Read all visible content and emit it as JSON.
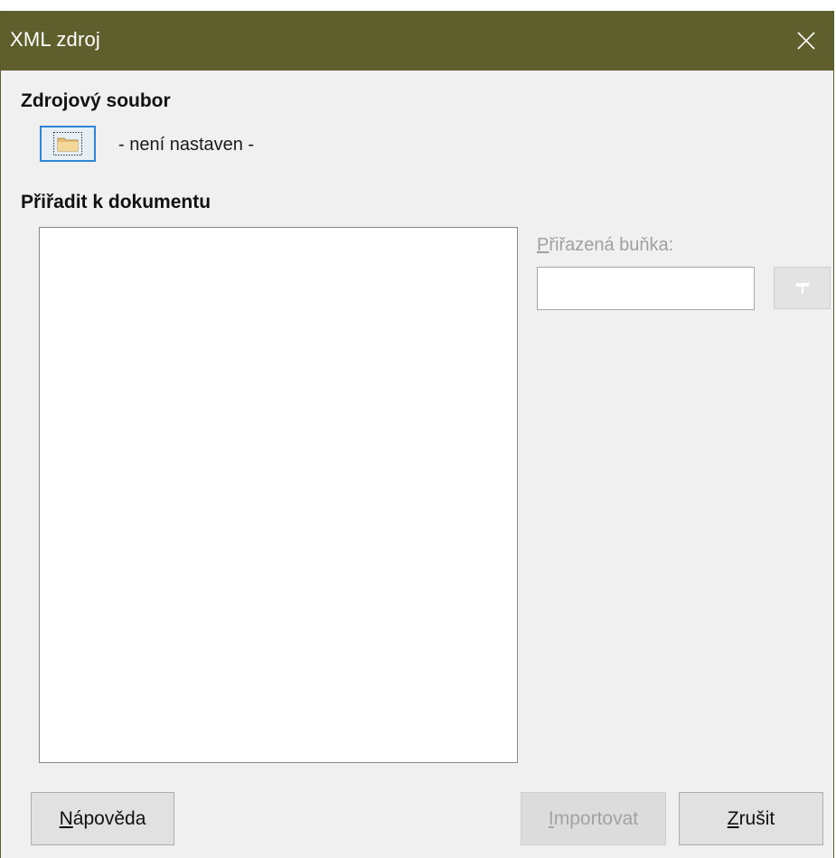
{
  "dialog": {
    "title": "XML zdroj",
    "close_icon": "close-icon"
  },
  "source_file": {
    "heading": "Zdrojový soubor",
    "browse_icon": "folder-icon",
    "status": "- není nastaven -"
  },
  "map_to_document": {
    "heading": "Přiřadit k dokumentu",
    "mapped_cell_label_first": "P",
    "mapped_cell_label_rest": "řiřazená buňka:",
    "mapped_cell_value": "",
    "shrink_icon": "shrink-icon"
  },
  "buttons": {
    "help_first": "N",
    "help_rest": "ápověda",
    "import_first": "I",
    "import_rest": "mportovat",
    "cancel_first": "Z",
    "cancel_rest": "rušit"
  },
  "colors": {
    "titlebar": "#5f5f2d",
    "focus_border": "#2f86d8",
    "dialog_bg": "#f0f0f0"
  }
}
